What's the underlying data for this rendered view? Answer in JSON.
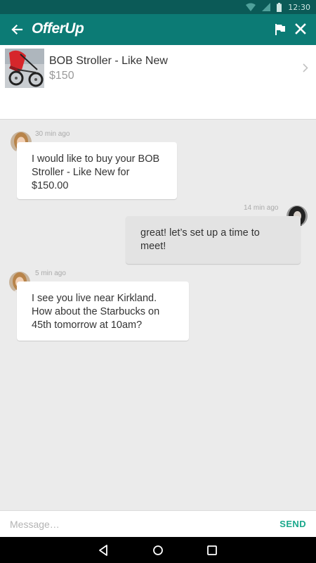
{
  "status_bar": {
    "time": "12:30",
    "icons": [
      "wifi-icon",
      "cell-signal-icon",
      "battery-icon"
    ]
  },
  "app_bar": {
    "logo": "OfferUp",
    "icons": [
      "back-arrow-icon",
      "flag-icon",
      "close-icon"
    ]
  },
  "listing": {
    "title": "BOB Stroller - Like New",
    "price": "$150"
  },
  "messages": [
    {
      "direction": "incoming",
      "time": "30 min ago",
      "lines": [
        "I would like to buy your BOB",
        "Stroller - Like New for",
        "$150.00"
      ]
    },
    {
      "direction": "outgoing",
      "time": "14 min ago",
      "lines": [
        "great! let’s set up a time to",
        "meet!"
      ]
    },
    {
      "direction": "incoming",
      "time": "5 min ago",
      "lines": [
        "I see you live near Kirkland.",
        "How about the Starbucks on",
        "45th tomorrow at 10am?"
      ]
    }
  ],
  "composer": {
    "placeholder": "Message…",
    "value": "",
    "send_label": "SEND"
  },
  "nav_bar": {
    "icons": [
      "back-triangle-icon",
      "home-circle-icon",
      "recents-square-icon"
    ]
  },
  "colors": {
    "status_bar": "#0b5a57",
    "app_bar": "#0c7b75",
    "accent_send": "#1aa88b",
    "chat_background": "#ebebeb",
    "incoming_bubble": "#ffffff",
    "outgoing_bubble": "#e3e3e3"
  }
}
